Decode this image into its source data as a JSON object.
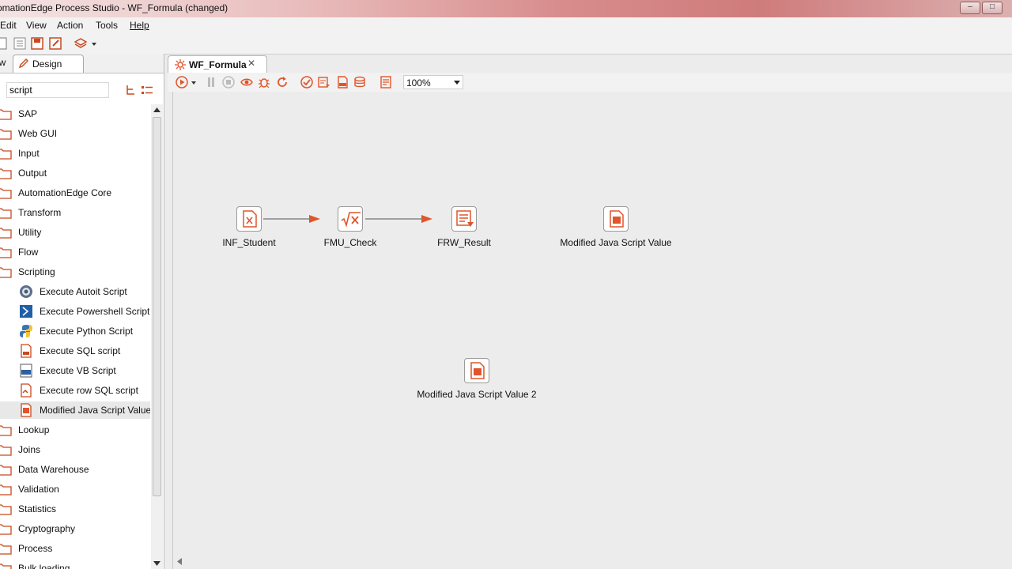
{
  "window": {
    "title": "omationEdge Process Studio - WF_Formula (changed)"
  },
  "menu": [
    "Edit",
    "View",
    "Action",
    "Tools",
    "Help"
  ],
  "left_panel": {
    "tabs": {
      "view": "ew",
      "design": "Design"
    },
    "search": {
      "value": "script"
    },
    "categories": [
      "SAP",
      "Web GUI",
      "Input",
      "Output",
      "AutomationEdge Core",
      "Transform",
      "Utility",
      "Flow",
      "Scripting"
    ],
    "scripting_children": [
      "Execute Autoit Script",
      "Execute Powershell Script",
      "Execute Python Script",
      "Execute SQL script",
      "Execute VB Script",
      "Execute row SQL script",
      "Modified Java Script Value"
    ],
    "categories_after": [
      "Lookup",
      "Joins",
      "Data Warehouse",
      "Validation",
      "Statistics",
      "Cryptography",
      "Process",
      "Bulk loading"
    ],
    "selected_item": "Modified Java Script Value"
  },
  "editor": {
    "tab_label": "WF_Formula",
    "zoom": "100%",
    "steps": [
      {
        "label": "INF_Student",
        "icon": "excel-input-icon"
      },
      {
        "label": "FMU_Check",
        "icon": "formula-icon"
      },
      {
        "label": "FRW_Result",
        "icon": "file-output-icon"
      },
      {
        "label": "Modified Java Script Value",
        "icon": "javascript-icon"
      },
      {
        "label": "Modified Java Script Value 2",
        "icon": "javascript-icon"
      }
    ]
  },
  "colors": {
    "accent": "#e0552b",
    "titlebar": "#d88d8d"
  }
}
